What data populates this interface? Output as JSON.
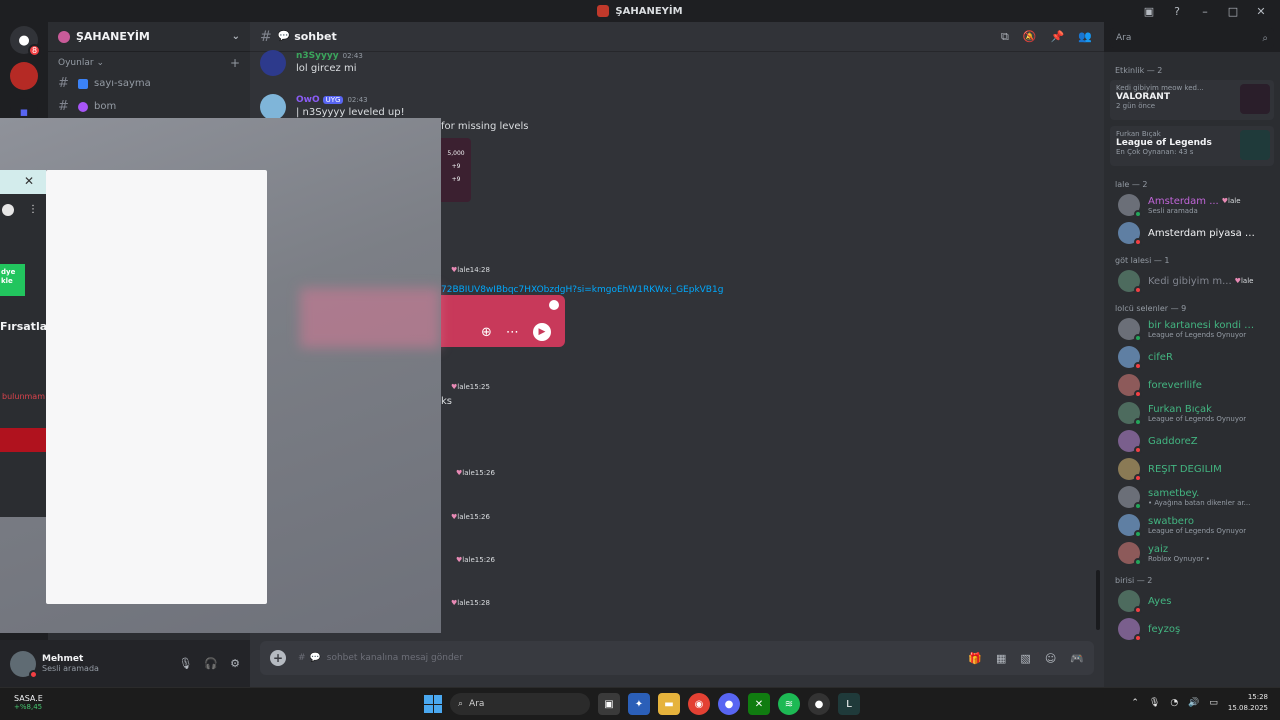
{
  "window": {
    "title": "ŞAHANEYİM"
  },
  "guild": {
    "name": "ŞAHANEYİM"
  },
  "sidebar": {
    "category": "Oyunlar",
    "channels": [
      {
        "name": "sayı-sayma"
      },
      {
        "name": "bom"
      }
    ]
  },
  "user": {
    "name": "Mehmet",
    "status": "Sesli aramada"
  },
  "channel": {
    "name": "sohbet"
  },
  "messages": [
    {
      "author": "n3Syyyy",
      "time": "02:43",
      "text": "lol gircez mi",
      "author_color": "#3ba55c"
    },
    {
      "author": "OwO",
      "tag": "UYG",
      "time": "02:43",
      "text": "| n3Syyyy leveled up!",
      "author_color": "#8b5cf6"
    }
  ],
  "partial_lines": {
    "missing_levels": "for missing levels",
    "img_val1": "5,000",
    "img_val2": "+9",
    "img_val3": "+9",
    "spotify_link": "72BBIUV8wIBbqc7HXObzdgH?si=kmgoEhW1RKWxi_GEpkVB1g",
    "ks": "ks",
    "firsat": "Fırsatları",
    "green_btn": "dye kle",
    "bulun": "bulunmam"
  },
  "message_meta": [
    {
      "role": "lale",
      "time": "14:28"
    },
    {
      "role": "lale",
      "time": "15:25"
    },
    {
      "role": "lale",
      "time": "15:26"
    },
    {
      "role": "lale",
      "time": "15:26"
    },
    {
      "role": "lale",
      "time": "15:26"
    },
    {
      "role": "lale",
      "time": "15:28"
    }
  ],
  "composer": {
    "placeholder": "sohbet kanalına mesaj gönder"
  },
  "search": {
    "placeholder": "Ara"
  },
  "members": {
    "activity_header": "Etkinlik — 2",
    "activities": [
      {
        "user": "Kedi gibiyim meow ked...",
        "game": "VALORANT",
        "sub": "2 gün önce",
        "art_color": "#2a1e2a"
      },
      {
        "user": "Furkan Bıçak",
        "game": "League of Legends",
        "sub": "En Çok Oynanan: 43 s",
        "art_color": "#1f3a3a"
      }
    ],
    "groups": [
      {
        "title": "lale — 2",
        "members": [
          {
            "name": "Amsterdam ...",
            "act": "Sesli aramada",
            "role": "lale",
            "color": "#c065d8"
          },
          {
            "name": "Amsterdam piyasa ba...",
            "act": "",
            "color": "#f2f3f5"
          }
        ]
      },
      {
        "title": "göt lalesi — 1",
        "members": [
          {
            "name": "Kedi gibiyim m...",
            "act": "",
            "role": "lale",
            "color": "#80848e"
          }
        ]
      },
      {
        "title": "lolcü selenler — 9",
        "members": [
          {
            "name": "bir kartanesi kondi dili...",
            "act": "League of Legends Oynuyor",
            "color": "#43b581"
          },
          {
            "name": "cifeR",
            "act": "",
            "color": "#43b581"
          },
          {
            "name": "foreverllife",
            "act": "",
            "color": "#43b581"
          },
          {
            "name": "Furkan Bıçak",
            "act": "League of Legends Oynuyor",
            "color": "#43b581"
          },
          {
            "name": "GaddoreZ",
            "act": "",
            "color": "#43b581"
          },
          {
            "name": "REŞİT DEĞİLİM",
            "act": "",
            "color": "#43b581"
          },
          {
            "name": "sametbey.",
            "act": "• Ayağına batan dikenler ar...",
            "color": "#43b581"
          },
          {
            "name": "swatbero",
            "act": "League of Legends Oynuyor",
            "color": "#43b581"
          },
          {
            "name": "yaiz",
            "act": "Roblox Oynuyor •",
            "color": "#43b581"
          }
        ]
      },
      {
        "title": "birisi — 2",
        "members": [
          {
            "name": "Ayes",
            "act": "",
            "color": "#43b581"
          },
          {
            "name": "feyzoş",
            "act": "",
            "color": "#43b581"
          }
        ]
      }
    ]
  },
  "taskbar": {
    "stock_name": "SASA.E",
    "stock_change": "+%8,45",
    "search_label": "Ara",
    "time": "15:28",
    "date": "15.08.2025"
  }
}
